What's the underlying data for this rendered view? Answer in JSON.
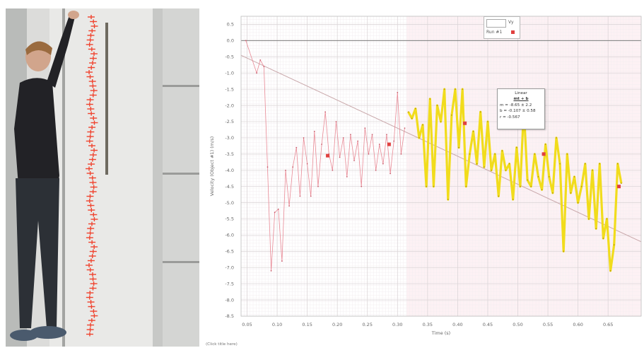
{
  "legend": {
    "swatch_label": "Vy",
    "run_label": "Run #1"
  },
  "fit": {
    "title": "Linear",
    "equation": "mt + b",
    "m": "m = -8.65 ± 2.2",
    "b": "b = -0.107 ± 0.58",
    "r": "r = -0.567"
  },
  "bottom_caption": "(Click title here)",
  "colors": {
    "raw_series": "#e98a96",
    "selected_series": "#f1dc1c",
    "fit_line": "#c9a8ab",
    "marker": "#e0403f",
    "selection_region": "#fdf1f4"
  },
  "chart_data": {
    "type": "line",
    "title": "",
    "xlabel": "Time (s)",
    "ylabel": "Velocity (Object #1) (m/s)",
    "xlim": [
      0.04,
      0.705
    ],
    "ylim": [
      -8.5,
      0.75
    ],
    "x_ticks": [
      "0.05",
      "0.10",
      "0.15",
      "0.20",
      "0.25",
      "0.30",
      "0.35",
      "0.40",
      "0.45",
      "0.50",
      "0.55",
      "0.60",
      "0.65"
    ],
    "y_ticks": [
      "0.5",
      "0.0",
      "-0.5",
      "-1.0",
      "-1.5",
      "-2.0",
      "-2.5",
      "-3.0",
      "-3.5",
      "-4.0",
      "-4.5",
      "-5.0",
      "-5.5",
      "-6.0",
      "-6.5",
      "-7.0",
      "-7.5",
      "-8.0",
      "-8.5"
    ],
    "y_tick_values": [
      0.5,
      0.0,
      -0.5,
      -1.0,
      -1.5,
      -2.0,
      -2.5,
      -3.0,
      -3.5,
      -4.0,
      -4.5,
      -5.0,
      -5.5,
      -6.0,
      -6.5,
      -7.0,
      -7.5,
      -8.0,
      -8.5
    ],
    "grid": true,
    "selected_range": [
      0.315,
      0.705
    ],
    "fit_line": {
      "slope": -8.65,
      "intercept": -0.107
    },
    "series": [
      {
        "x": [
          0.048,
          0.066,
          0.072,
          0.078,
          0.084,
          0.09,
          0.096,
          0.102,
          0.108,
          0.114,
          0.12,
          0.126,
          0.132,
          0.138,
          0.144,
          0.15,
          0.156,
          0.162,
          0.168,
          0.174,
          0.18,
          0.186,
          0.192,
          0.198,
          0.204,
          0.21,
          0.216,
          0.222,
          0.228,
          0.234,
          0.24,
          0.246,
          0.252,
          0.258,
          0.264,
          0.27,
          0.276,
          0.282,
          0.288,
          0.294,
          0.3,
          0.306,
          0.312
        ],
        "values": [
          0.0,
          -1.0,
          -0.6,
          -0.8,
          -3.9,
          -7.1,
          -5.3,
          -5.2,
          -6.8,
          -4.0,
          -5.1,
          -3.9,
          -3.3,
          -4.8,
          -3.0,
          -3.8,
          -4.8,
          -2.8,
          -4.5,
          -3.2,
          -2.2,
          -3.5,
          -4.0,
          -2.5,
          -3.6,
          -3.0,
          -4.2,
          -2.9,
          -3.7,
          -3.1,
          -4.5,
          -2.7,
          -3.5,
          -2.9,
          -4.0,
          -3.2,
          -3.8,
          -2.9,
          -4.1,
          -3.1,
          -1.6,
          -3.5,
          -2.7
        ],
        "markers_x": [
          0.184,
          0.286
        ],
        "markers_y": [
          -3.55,
          -3.2
        ]
      },
      {
        "x": [
          0.318,
          0.324,
          0.33,
          0.336,
          0.342,
          0.348,
          0.354,
          0.36,
          0.366,
          0.372,
          0.378,
          0.384,
          0.39,
          0.396,
          0.402,
          0.408,
          0.414,
          0.42,
          0.426,
          0.432,
          0.438,
          0.444,
          0.45,
          0.456,
          0.462,
          0.468,
          0.474,
          0.48,
          0.486,
          0.492,
          0.498,
          0.504,
          0.51,
          0.516,
          0.522,
          0.528,
          0.534,
          0.54,
          0.546,
          0.552,
          0.558,
          0.564,
          0.57,
          0.576,
          0.582,
          0.588,
          0.594,
          0.6,
          0.606,
          0.612,
          0.618,
          0.624,
          0.63,
          0.636,
          0.642,
          0.648,
          0.654,
          0.66,
          0.666,
          0.672
        ],
        "values": [
          -2.2,
          -2.4,
          -2.1,
          -3.0,
          -2.6,
          -4.5,
          -1.8,
          -4.5,
          -2.0,
          -2.5,
          -1.5,
          -4.9,
          -2.3,
          -1.5,
          -3.3,
          -1.5,
          -4.5,
          -3.5,
          -2.8,
          -3.8,
          -2.2,
          -3.9,
          -2.5,
          -4.0,
          -3.5,
          -4.8,
          -3.4,
          -4.0,
          -3.8,
          -4.9,
          -3.3,
          -4.5,
          -2.1,
          -4.3,
          -4.5,
          -3.5,
          -4.2,
          -4.6,
          -3.2,
          -4.2,
          -4.7,
          -3.0,
          -3.8,
          -6.5,
          -3.5,
          -4.7,
          -4.2,
          -5.0,
          -4.5,
          -3.8,
          -5.5,
          -4.0,
          -5.8,
          -3.8,
          -6.1,
          -5.5,
          -7.1,
          -6.3,
          -3.8,
          -4.4
        ],
        "markers_x": [
          0.412,
          0.543,
          0.668
        ],
        "markers_y": [
          -2.55,
          -3.5,
          -4.5
        ]
      }
    ]
  }
}
